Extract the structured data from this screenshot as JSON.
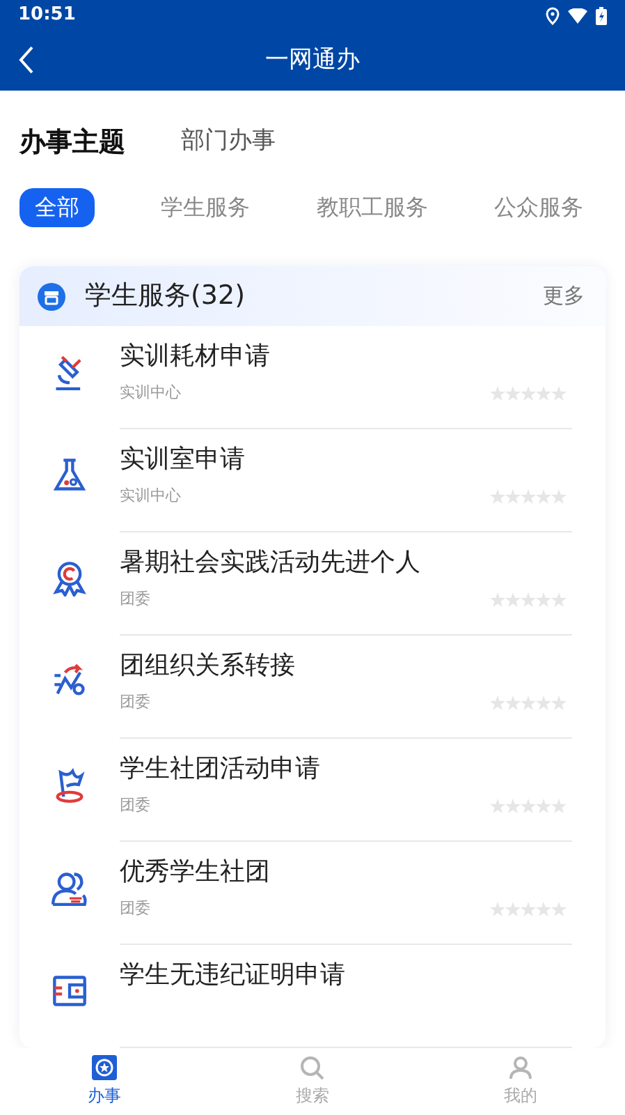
{
  "status_bar": {
    "time": "10:51"
  },
  "header": {
    "title": "一网通办"
  },
  "top_tabs": [
    {
      "label": "办事主题",
      "selected": true
    },
    {
      "label": "部门办事",
      "selected": false
    }
  ],
  "filters": [
    {
      "label": "全部",
      "selected": true
    },
    {
      "label": "学生服务",
      "selected": false
    },
    {
      "label": "教职工服务",
      "selected": false
    },
    {
      "label": "公众服务",
      "selected": false
    }
  ],
  "section": {
    "title": "学生服务(32)",
    "more": "更多"
  },
  "items": [
    {
      "kind": "microscope",
      "title": "实训耗材申请",
      "department": "实训中心",
      "stars": 0
    },
    {
      "kind": "flask",
      "title": "实训室申请",
      "department": "实训中心",
      "stars": 0
    },
    {
      "kind": "medal",
      "title": "暑期社会实践活动先进个人",
      "department": "团委",
      "stars": 0
    },
    {
      "kind": "transfer",
      "title": "团组织关系转接",
      "department": "团委",
      "stars": 0
    },
    {
      "kind": "flag",
      "title": "学生社团活动申请",
      "department": "团委",
      "stars": 0
    },
    {
      "kind": "people",
      "title": "优秀学生社团",
      "department": "团委",
      "stars": 0
    },
    {
      "kind": "wallet",
      "title": "学生无违纪证明申请"
    }
  ],
  "bottom_nav": [
    {
      "label": "办事",
      "selected": true
    },
    {
      "label": "搜索",
      "selected": false
    },
    {
      "label": "我的",
      "selected": false
    }
  ]
}
